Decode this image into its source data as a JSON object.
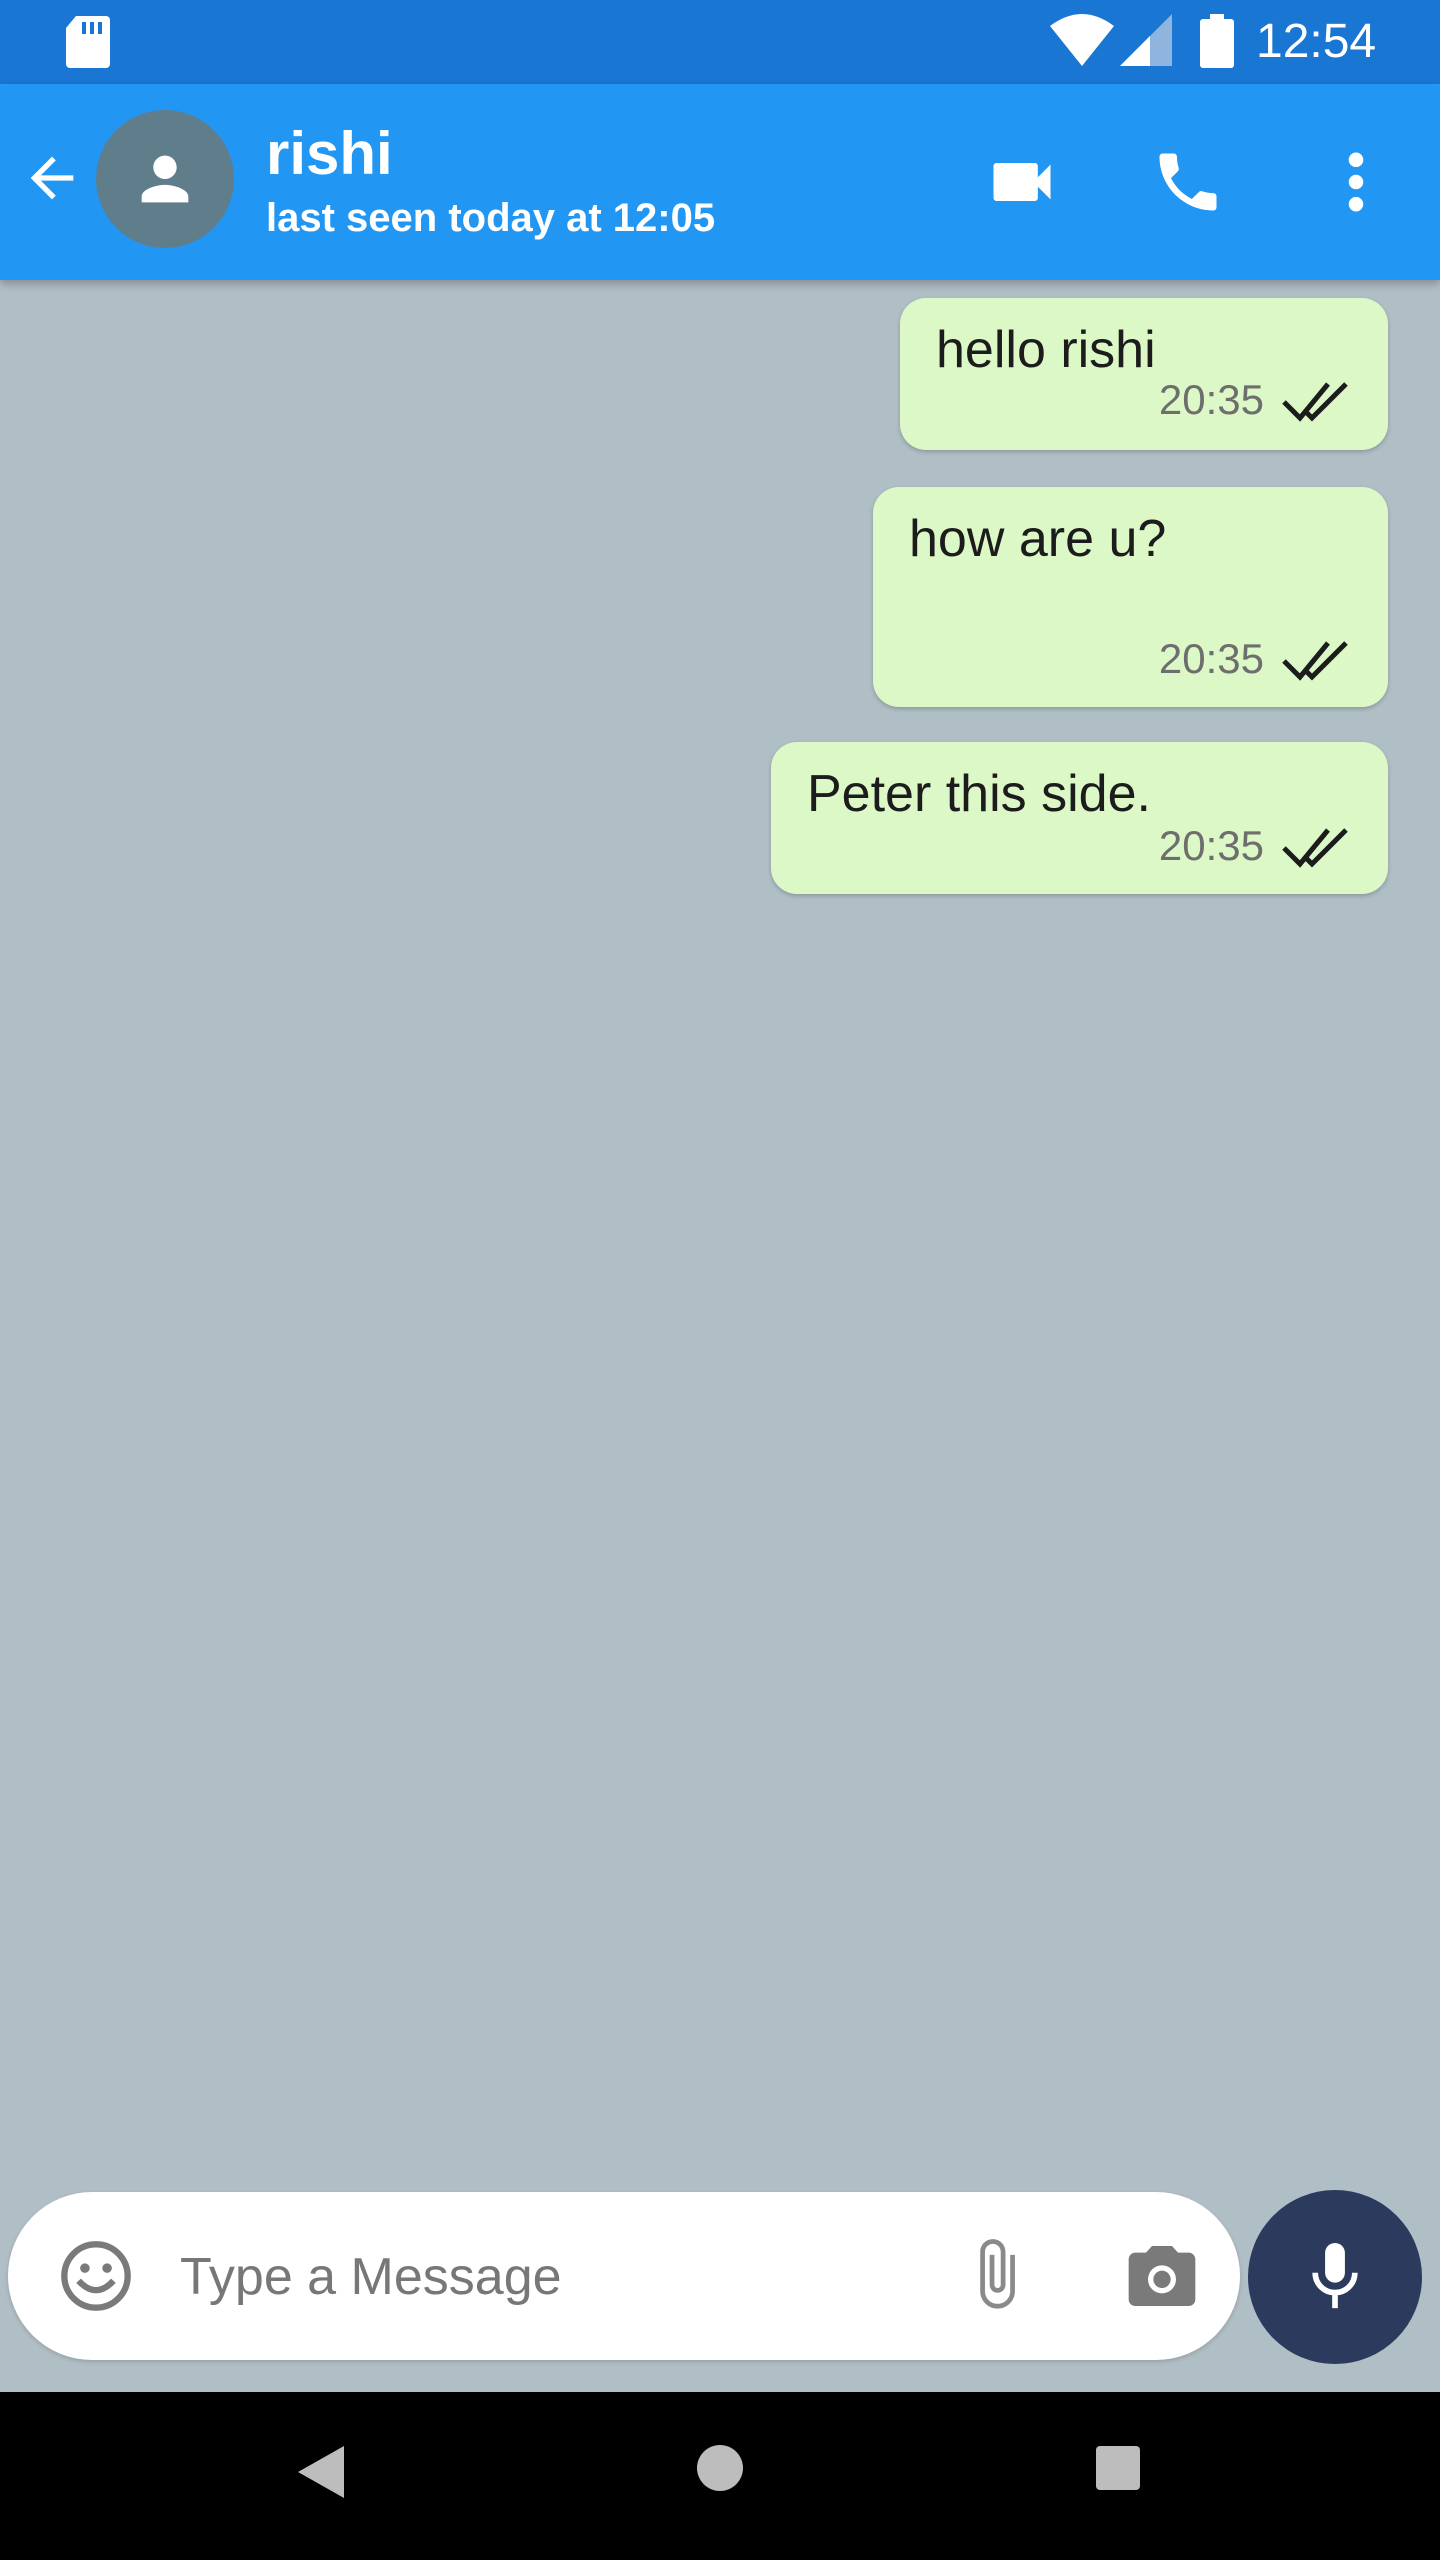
{
  "status_bar": {
    "time": "12:54",
    "icons": [
      "sd-card-icon",
      "wifi-icon",
      "signal-icon",
      "battery-icon"
    ]
  },
  "header": {
    "contact_name": "rishi",
    "last_seen": "last seen today at 12:05",
    "icons": [
      "back-arrow-icon",
      "avatar-person-icon",
      "video-call-icon",
      "phone-call-icon",
      "more-vert-icon"
    ]
  },
  "messages": [
    {
      "text": "hello rishi",
      "time": "20:35",
      "status": "read",
      "outgoing": true
    },
    {
      "text": "how are u?",
      "time": "20:35",
      "status": "read",
      "outgoing": true
    },
    {
      "text": "Peter this side.",
      "time": "20:35",
      "status": "read",
      "outgoing": true
    }
  ],
  "composer": {
    "placeholder": "Type a Message",
    "value": "",
    "icons": [
      "emoji-icon",
      "attach-icon",
      "camera-icon",
      "mic-icon"
    ]
  },
  "nav_bar": {
    "icons": [
      "nav-back-icon",
      "nav-home-icon",
      "nav-recents-icon"
    ]
  },
  "colors": {
    "status_bar": "#1976d2",
    "app_bar": "#2196f3",
    "chat_background": "#b0bec5",
    "outgoing_bubble": "#dcf8c6",
    "mic_button": "#2c3a5e",
    "avatar_bg": "#607d8b"
  }
}
